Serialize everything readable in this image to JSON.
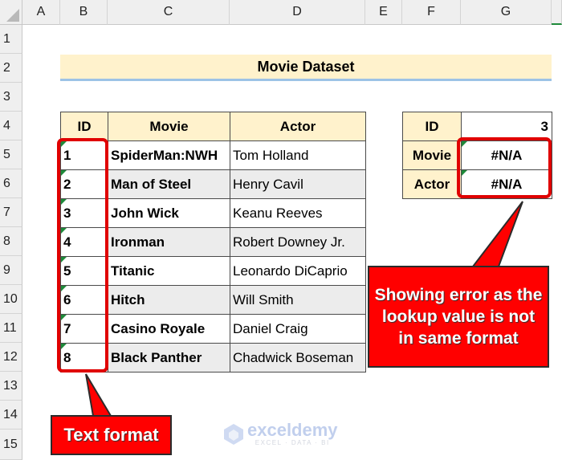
{
  "sheet": {
    "columns": [
      "A",
      "B",
      "C",
      "D",
      "E",
      "F",
      "G"
    ],
    "rows": [
      "1",
      "2",
      "3",
      "4",
      "5",
      "6",
      "7",
      "8",
      "9",
      "10",
      "11",
      "12",
      "13",
      "14",
      "15"
    ]
  },
  "title": "Movie Dataset",
  "table": {
    "headers": [
      "ID",
      "Movie",
      "Actor"
    ],
    "rows": [
      {
        "id": "1",
        "movie": "SpiderMan:NWH",
        "actor": "Tom Holland"
      },
      {
        "id": "2",
        "movie": "Man of Steel",
        "actor": "Henry Cavil"
      },
      {
        "id": "3",
        "movie": "John Wick",
        "actor": "Keanu Reeves"
      },
      {
        "id": "4",
        "movie": "Ironman",
        "actor": "Robert Downey Jr."
      },
      {
        "id": "5",
        "movie": "Titanic",
        "actor": "Leonardo DiCaprio"
      },
      {
        "id": "6",
        "movie": "Hitch",
        "actor": "Will Smith"
      },
      {
        "id": "7",
        "movie": "Casino Royale",
        "actor": "Daniel Craig"
      },
      {
        "id": "8",
        "movie": "Black Panther",
        "actor": "Chadwick Boseman"
      }
    ]
  },
  "lookup": {
    "id_label": "ID",
    "id_value": "3",
    "movie_label": "Movie",
    "movie_value": "#N/A",
    "actor_label": "Actor",
    "actor_value": "#N/A"
  },
  "callouts": {
    "error_note": "Showing error as the lookup value is not in same format",
    "text_format_note": "Text format"
  },
  "watermark": {
    "name": "exceldemy",
    "tagline": "EXCEL · DATA · BI"
  },
  "colors": {
    "header_fill": "#fff2cc",
    "callout_red": "#ff0000",
    "highlight_border": "#e00000",
    "text_indicator": "#1e8a3a"
  }
}
